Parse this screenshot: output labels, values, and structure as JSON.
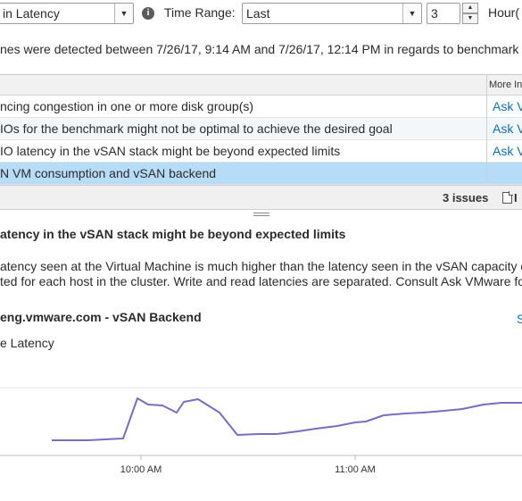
{
  "toolbar": {
    "metric_select": "in Latency",
    "time_range_label": "Time Range:",
    "range_select": "Last",
    "range_value": "3",
    "unit_label": "Hour("
  },
  "summary_text": "nes were detected between 7/26/17, 9:14 AM and 7/26/17, 12:14 PM in regards to benchmark goal",
  "issues_table": {
    "more_info_header": "More In",
    "rows": [
      {
        "text": "ncing congestion in one or more disk group(s)",
        "link": "Ask V"
      },
      {
        "text": "IOs for the benchmark might not be optimal to achieve the desired goal",
        "link": "Ask V"
      },
      {
        "text": "IO latency in the vSAN stack might be beyond expected limits",
        "link": "Ask V"
      },
      {
        "text": "N VM consumption and vSAN backend",
        "link": ""
      }
    ],
    "issue_count": "3 issues",
    "export_extra": "I"
  },
  "detail": {
    "title": "atency in the vSAN stack might be beyond expected limits",
    "description_line1": "atency seen at the Virtual Machine is much higher than the latency seen in the vSAN capacity devi",
    "description_line2": "ted for each host in the cluster. Write and read latencies are separated. Consult Ask VMware for a"
  },
  "chart": {
    "host_title": "eng.vmware.com - vSAN Backend",
    "side_link": "S",
    "series_label": "e Latency"
  },
  "chart_data": {
    "type": "line",
    "x_ticks": [
      "10:00 AM",
      "11:00 AM"
    ],
    "x": [
      "9:35",
      "9:45",
      "9:50",
      "9:55",
      "9:59",
      "10:02",
      "10:06",
      "10:10",
      "10:12",
      "10:16",
      "10:22",
      "10:27",
      "10:33",
      "10:38",
      "10:44",
      "10:49",
      "10:55",
      "11:00",
      "11:03",
      "11:08",
      "11:14",
      "11:19",
      "11:25",
      "11:30",
      "11:36",
      "11:41",
      "11:47",
      "11:52"
    ],
    "series": [
      {
        "color": "#7b6cc0",
        "values": [
          0.17,
          0.17,
          0.18,
          0.19,
          0.64,
          0.57,
          0.56,
          0.48,
          0.6,
          0.63,
          0.48,
          0.23,
          0.24,
          0.24,
          0.27,
          0.3,
          0.33,
          0.37,
          0.38,
          0.45,
          0.47,
          0.48,
          0.5,
          0.52,
          0.57,
          0.59,
          0.59,
          0.61
        ]
      }
    ],
    "grid": false
  }
}
